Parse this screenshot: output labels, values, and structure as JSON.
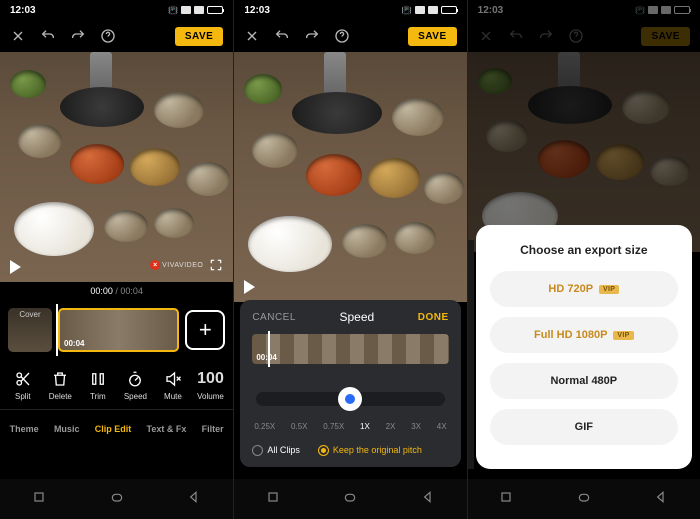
{
  "status": {
    "time": "12:03"
  },
  "topbar": {
    "save": "SAVE"
  },
  "watermark": {
    "text": "VIVAVIDEO"
  },
  "s1": {
    "time_current": "00:00",
    "time_total": "00:04",
    "cover_label": "Cover",
    "clip_duration": "00:04",
    "tools": {
      "split": "Split",
      "delete": "Delete",
      "trim": "Trim",
      "speed": "Speed",
      "mute": "Mute",
      "volume_value": "100",
      "volume_label": "Volume"
    },
    "tabs": {
      "theme": "Theme",
      "music": "Music",
      "clip_edit": "Clip Edit",
      "text_fx": "Text & Fx",
      "filter": "Filter"
    }
  },
  "s2": {
    "cancel": "CANCEL",
    "title": "Speed",
    "done": "DONE",
    "clip_duration": "00:04",
    "marks": [
      "0.25X",
      "0.5X",
      "0.75X",
      "1X",
      "2X",
      "3X",
      "4X"
    ],
    "all_clips": "All Clips",
    "keep_pitch": "Keep the original pitch"
  },
  "s3": {
    "sheet_title": "Choose an export size",
    "opt_720": "HD 720P",
    "opt_1080": "Full HD 1080P",
    "opt_480": "Normal 480P",
    "opt_gif": "GIF",
    "vip": "VIP"
  }
}
